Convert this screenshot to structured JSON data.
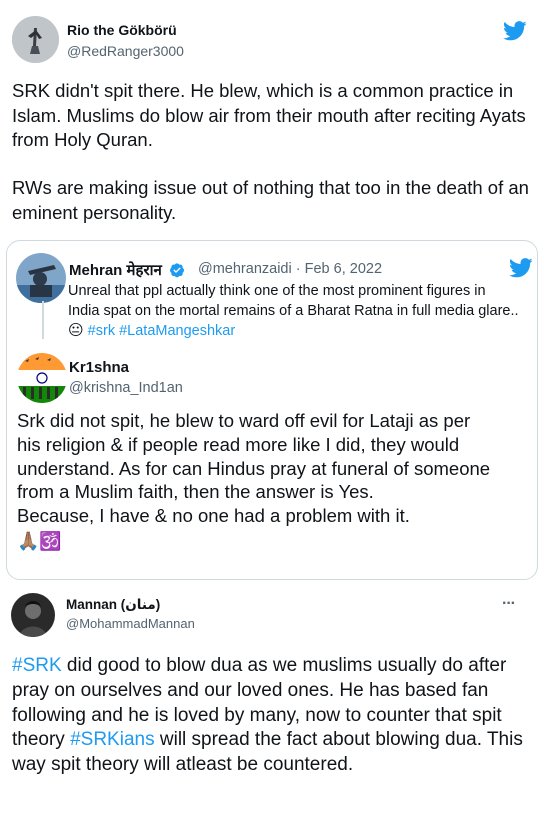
{
  "tweet1": {
    "author_name": "Rio the Gökbörü",
    "author_handle": "@RedRanger3000",
    "paragraph1": "SRK didn't spit there. He blew, which is a common practice in Islam. Muslims do blow air from their mouth after reciting Ayats from Holy Quran.",
    "paragraph2": "RWs are making issue out of nothing that too in the death of an eminent personality."
  },
  "quote": {
    "author_name": "Mehran मेहरान",
    "author_handle": "@mehranzaidi",
    "separator": "·",
    "date": "Feb 6, 2022",
    "text_line1": "Unreal that ppl actually think one of the most prominent figures in",
    "text_line2": "India spat on the mortal remains of a Bharat Ratna in full media glare..",
    "emoji": "😐",
    "hashtags": [
      "#srk",
      "#LataMangeshkar"
    ]
  },
  "reply": {
    "author_name": "Kr1shna",
    "author_handle": "@krishna_Ind1an",
    "text_line1": "Srk did not spit, he blew to ward off evil for Lataji as per",
    "text_line2": "his religion & if people read more like I did, they would",
    "text_line3": "understand. As for can Hindus pray at funeral of someone",
    "text_line4": "from a Muslim faith, then the answer is Yes.",
    "text_line5": "Because, I have & no one had a problem with it.",
    "emojis": "🙏🏽🕉️"
  },
  "tweet2": {
    "author_name": "Mannan (منان)",
    "author_handle": "@MohammadMannan",
    "more_label": "···",
    "hashtag1": "#SRK",
    "text_part1": " did good to blow dua as we muslims usually do after pray on ourselves and our loved ones. He has based fan following and he is loved by many, now to counter that spit theory ",
    "hashtag2": "#SRKians",
    "text_part2": " will spread the fact about blowing dua. This way spit theory will atleast be countered."
  },
  "colors": {
    "twitter_blue": "#1d9bf0",
    "text_primary": "#0f1419",
    "text_secondary": "#536471",
    "border": "#cfd9de"
  },
  "icons": {
    "twitter_logo": "twitter-bird-icon",
    "verified_badge": "verified-badge-icon"
  }
}
